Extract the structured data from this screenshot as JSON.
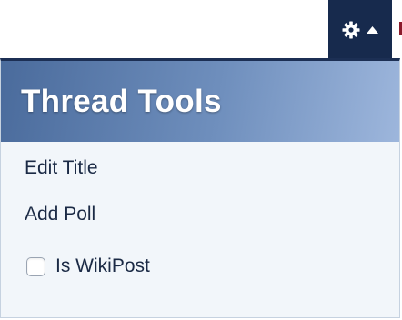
{
  "toolbar": {
    "gear_icon": "gear-icon",
    "caret_icon": "caret-up-icon",
    "button_color": "#172a4d"
  },
  "thread_tools": {
    "title": "Thread Tools",
    "items": [
      {
        "label": "Edit Title"
      },
      {
        "label": "Add Poll"
      }
    ],
    "wiki_checkbox": {
      "label": "Is WikiPost",
      "checked": false
    },
    "header_gradient": [
      "#4a6b9c",
      "#9db6dc"
    ],
    "panel_background": "#f2f6fa"
  }
}
